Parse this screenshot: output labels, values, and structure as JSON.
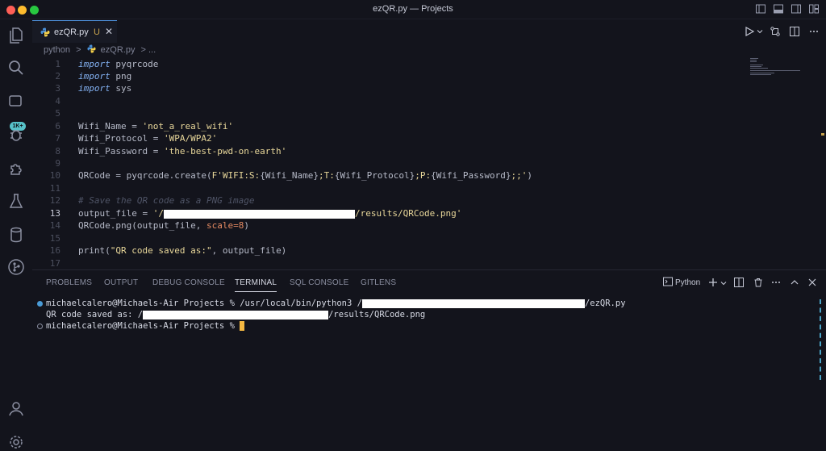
{
  "window": {
    "title": "ezQR.py — Projects"
  },
  "activity": {
    "badge": "1K+"
  },
  "tab": {
    "label": "ezQR.py",
    "modified": "U",
    "close": "✕"
  },
  "breadcrumb": {
    "folder": "python",
    "sep": ">",
    "file": "ezQR.py",
    "more": "> ..."
  },
  "code_lines": [
    {
      "n": "1"
    },
    {
      "n": "2"
    },
    {
      "n": "3"
    },
    {
      "n": "4"
    },
    {
      "n": "5"
    },
    {
      "n": "6"
    },
    {
      "n": "7"
    },
    {
      "n": "8"
    },
    {
      "n": "9"
    },
    {
      "n": "10"
    },
    {
      "n": "11"
    },
    {
      "n": "12"
    },
    {
      "n": "13"
    },
    {
      "n": "14"
    },
    {
      "n": "15"
    },
    {
      "n": "16"
    },
    {
      "n": "17"
    }
  ],
  "code": {
    "l1_kw": "import",
    "l1_mod": " pyqrcode",
    "l2_kw": "import",
    "l2_mod": " png",
    "l3_kw": "import",
    "l3_mod": " sys",
    "l6_var": "Wifi_Name = ",
    "l6_str": "'not_a_real_wifi'",
    "l7_var": "Wifi_Protocol = ",
    "l7_str": "'WPA/WPA2'",
    "l8_var": "Wifi_Password = ",
    "l8_str": "'the-best-pwd-on-earth'",
    "l10_a": "QRCode = pyqrcode.create(",
    "l10_b": "F'WIFI:S:",
    "l10_c": "{Wifi_Name}",
    "l10_d": ";T:",
    "l10_e": "{Wifi_Protocol}",
    "l10_f": ";P:",
    "l10_g": "{Wifi_Password}",
    "l10_h": ";;'",
    "l10_i": ")",
    "l12_cmt": "# Save the QR code as a PNG image",
    "l13_var": "output_file = ",
    "l13_s1": "'/",
    "l13_s2": "/results/QRCode.png'",
    "l14_a": "QRCode.png(",
    "l14_b": "output_file, ",
    "l14_c": "scale",
    "l14_d": "=",
    "l14_e": "8",
    "l14_f": ")",
    "l16_a": "print(",
    "l16_b": "\"QR code saved as:\"",
    "l16_c": ", output_file)"
  },
  "panel": {
    "tabs": [
      "PROBLEMS",
      "OUTPUT",
      "DEBUG CONSOLE",
      "TERMINAL",
      "SQL CONSOLE",
      "GITLENS"
    ],
    "profile": "Python"
  },
  "terminal": {
    "line1_a": "michaelcalero@Michaels-Air Projects % /usr/local/bin/python3 /",
    "line1_b": "/ezQR.py",
    "line2_a": "QR code saved as: /",
    "line2_b": "/results/QRCode.png",
    "line3": "michaelcalero@Michaels-Air Projects % "
  },
  "colors": {
    "accent": "#4c8dd6",
    "badge": "#57c2c9",
    "cursor": "#f5b942",
    "modified": "#c7a24d"
  }
}
